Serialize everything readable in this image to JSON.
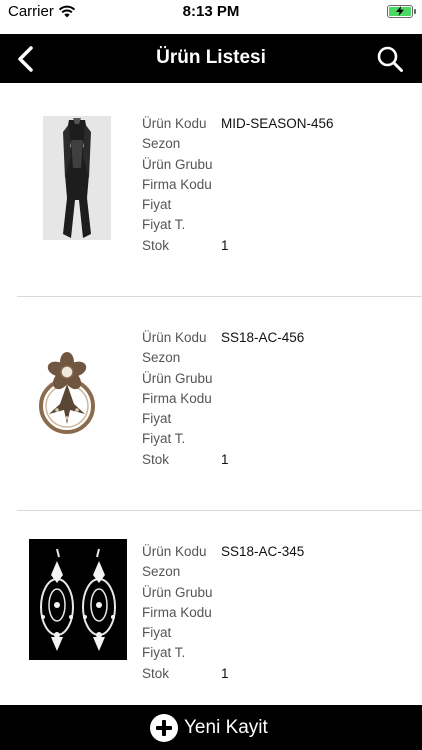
{
  "status_bar": {
    "carrier": "Carrier",
    "time": "8:13 PM"
  },
  "nav": {
    "title": "Ürün Listesi",
    "back_icon": "chevron-left-icon",
    "search_icon": "search-icon"
  },
  "field_labels": {
    "code": "Ürün Kodu",
    "season": "Sezon",
    "group": "Ürün Grubu",
    "company_code": "Firma Kodu",
    "price": "Fiyat",
    "price_type": "Fiyat T.",
    "stock": "Stok"
  },
  "products": [
    {
      "code": "MID-SEASON-456",
      "season": "",
      "group": "",
      "company_code": "",
      "price": "",
      "price_type": "",
      "stock": "1",
      "image": "black-dress-photo"
    },
    {
      "code": "SS18-AC-456",
      "season": "",
      "group": "",
      "company_code": "",
      "price": "",
      "price_type": "",
      "stock": "1",
      "image": "flower-brooch-photo"
    },
    {
      "code": "SS18-AC-345",
      "season": "",
      "group": "",
      "company_code": "",
      "price": "",
      "price_type": "",
      "stock": "1",
      "image": "crystal-earrings-photo"
    }
  ],
  "footer": {
    "add_label": "Yeni Kayit",
    "add_icon": "plus-circle-icon"
  },
  "colors": {
    "bar_background": "#000000",
    "battery_fill": "#4cd964",
    "divider": "#d9d9d9"
  }
}
